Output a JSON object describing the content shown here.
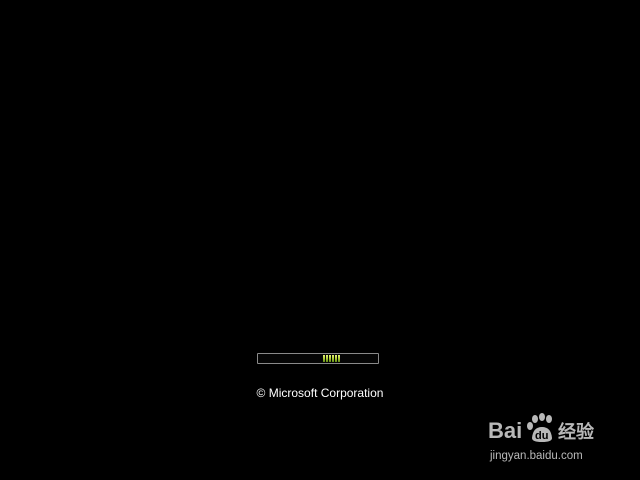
{
  "boot": {
    "progress_segments": 6,
    "copyright": "© Microsoft Corporation"
  },
  "watermark": {
    "brand": "Baidu 经验",
    "url": "jingyan.baidu.com"
  },
  "colors": {
    "background": "#000000",
    "progress_segment": "#b6d43a",
    "text": "#ffffff"
  }
}
